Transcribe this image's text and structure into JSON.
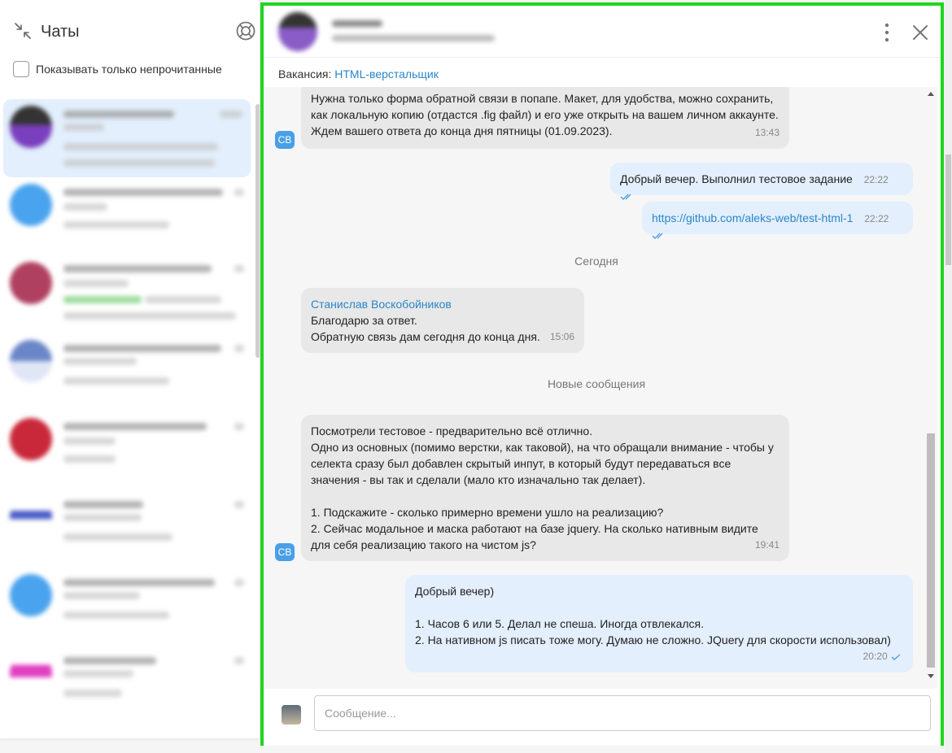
{
  "sidebar": {
    "title": "Чаты",
    "unread_only_label": "Показывать только непрочитанные",
    "unread_only_checked": false
  },
  "chat_header": {
    "vacancy_prefix": "Вакансия:",
    "vacancy_link": "HTML-верстальщик"
  },
  "messages": {
    "m1": {
      "lines": "Нужна только форма обратной связи в попапе. Макет, для удобства, можно сохранить,\nкак локальную копию (отдастся .fig файл) и его уже открыть на вашем личном аккаунте.\nЖдем вашего ответа до конца дня пятницы (01.09.2023).",
      "time": "13:43",
      "avatar": "СВ"
    },
    "m2": {
      "text": "Добрый вечер. Выполнил тестовое задание",
      "time": "22:22",
      "status": "double-check"
    },
    "m3": {
      "link": "https://github.com/aleks-web/test-html-1",
      "time": "22:22",
      "status": "double-check"
    },
    "divider_today": "Сегодня",
    "m4": {
      "sender": "Станислав Воскобойников",
      "lines": "Благодарю за ответ.\nОбратную связь дам сегодня до конца дня.",
      "time": "15:06"
    },
    "divider_new": "Новые сообщения",
    "m5": {
      "lines": "Посмотрели тестовое - предварительно всё отлично.\nОдно из основных (помимо верстки, как таковой), на что обращали внимание - чтобы у\nселекта сразу был добавлен скрытый инпут, в который будут передаваться все\nзначения - вы так и сделали (мало кто изначально так делает).\n\n1. Подскажите - сколько примерно времени ушло на реализацию?\n2. Сейчас модальное и маска работают на базе jquery. На сколько нативным видите\nдля себя реализацию такого на чистом js?",
      "time": "19:41",
      "avatar": "СВ"
    },
    "m6": {
      "lines": "Добрый вечер)\n\n1. Часов 6 или 5. Делал не спеша. Иногда отвлекался.\n2. На нативном js писать тоже могу. Думаю не сложно. JQuery для скорости использовал)",
      "time": "20:20",
      "status": "single-check"
    }
  },
  "composer": {
    "placeholder": "Сообщение...",
    "value": ""
  },
  "colors": {
    "accent": "#2a86c9",
    "highlight_border": "#1fd61f",
    "incoming_bubble": "#e8e8e8",
    "outgoing_bubble": "#e3effc"
  }
}
